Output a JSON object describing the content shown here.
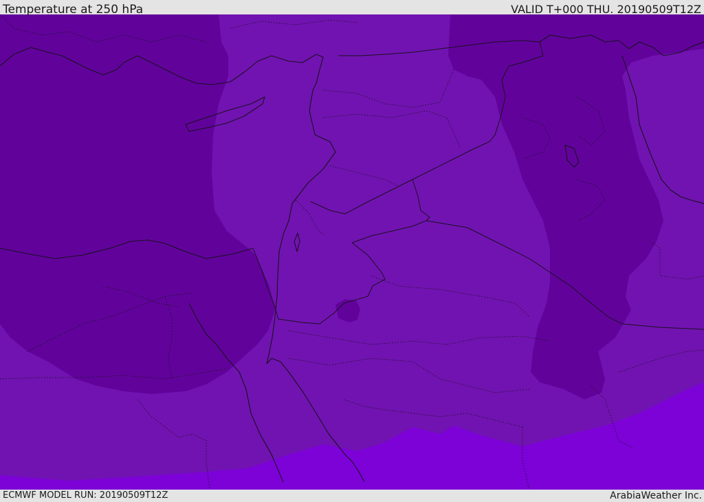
{
  "header": {
    "title": "Temperature at 250 hPa",
    "valid_time": "VALID T+000 THU. 20190509T12Z"
  },
  "footer": {
    "model_run": "ECMWF MODEL RUN: 20190509T12Z",
    "credit": "ArabiaWeather Inc."
  },
  "colors": {
    "band_cold": "#61039b",
    "band_mid": "#7113b1",
    "band_warm": "#7c02d8",
    "coast": "#1a1020",
    "frame_bg": "#e4e4e4"
  }
}
